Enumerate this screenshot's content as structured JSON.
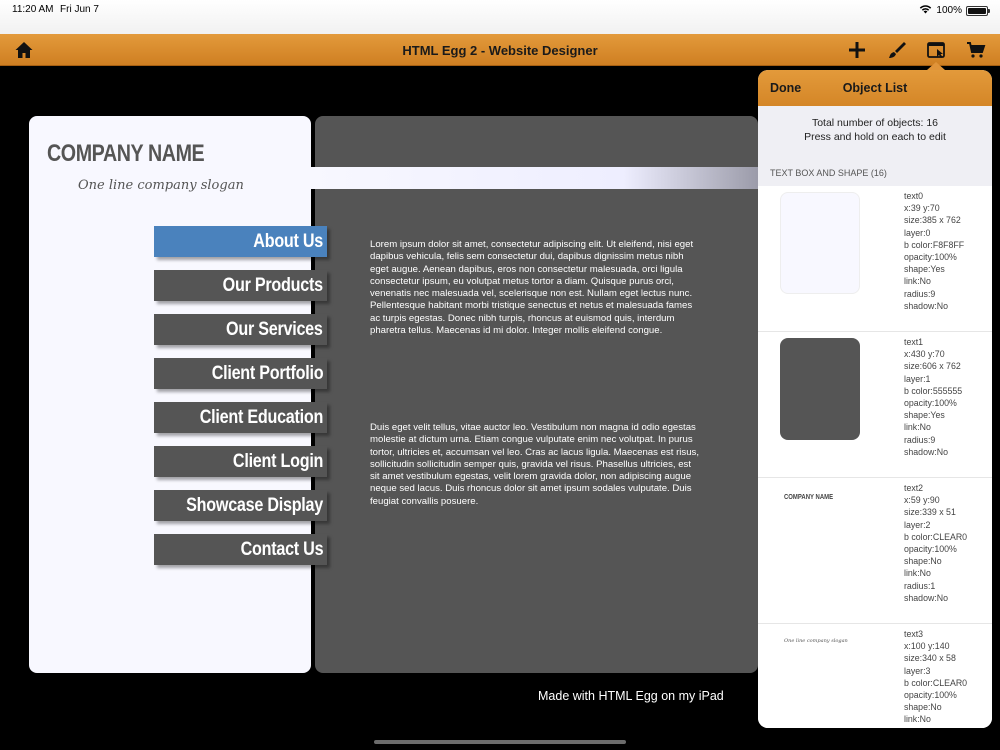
{
  "status_bar": {
    "time": "11:20 AM",
    "date": "Fri Jun 7",
    "battery": "100%"
  },
  "toolbar": {
    "title": "HTML Egg 2 - Website Designer",
    "icons": [
      "home-icon",
      "plus-icon",
      "brush-icon",
      "object-list-icon",
      "cart-icon"
    ]
  },
  "site": {
    "company_name": "COMPANY NAME",
    "slogan": "One line company slogan",
    "nav": [
      {
        "label": "About Us",
        "active": true
      },
      {
        "label": "Our Products",
        "active": false
      },
      {
        "label": "Our Services",
        "active": false
      },
      {
        "label": "Client Portfolio",
        "active": false
      },
      {
        "label": "Client Education",
        "active": false
      },
      {
        "label": "Client Login",
        "active": false
      },
      {
        "label": "Showcase Display",
        "active": false
      },
      {
        "label": "Contact Us",
        "active": false
      }
    ],
    "para1": "Lorem ipsum dolor sit amet, consectetur adipiscing elit. Ut eleifend, nisi eget dapibus vehicula, felis sem consectetur dui, dapibus dignissim metus nibh eget augue. Aenean dapibus, eros non consectetur malesuada, orci ligula consectetur ipsum, eu volutpat metus tortor a diam. Quisque purus orci, venenatis nec malesuada vel, scelerisque non est. Nullam eget lectus nunc. Pellentesque habitant morbi tristique senectus et netus et malesuada fames ac turpis egestas. Donec nibh turpis, rhoncus at euismod quis, interdum pharetra tellus. Maecenas id mi dolor. Integer mollis eleifend congue.",
    "para2": "Duis eget velit tellus, vitae auctor leo. Vestibulum non magna id odio egestas molestie at dictum urna. Etiam congue vulputate enim nec volutpat. In purus tortor, ultricies et, accumsan vel leo. Cras ac lacus ligula. Maecenas est risus, sollicitudin sollicitudin semper quis, gravida vel risus. Phasellus ultricies, est sit amet vestibulum egestas, velit lorem gravida dolor, non adipiscing augue neque sed lacus. Duis rhoncus dolor sit amet ipsum sodales vulputate. Duis feugiat convallis posuere.",
    "footer": "Made with HTML Egg on my iPad"
  },
  "popover": {
    "done": "Done",
    "title": "Object List",
    "info_line1": "Total number of objects: 16",
    "info_line2": "Press and hold on each to edit",
    "section": "TEXT BOX AND SHAPE (16)",
    "objects": [
      {
        "lines": [
          "text0",
          "x:39 y:70",
          "size:385 x 762",
          "layer:0",
          "b color:F8F8FF",
          "opacity:100%",
          "shape:Yes",
          "link:No",
          "radius:9",
          "shadow:No"
        ],
        "thumb_color": "#F8F8FF"
      },
      {
        "lines": [
          "text1",
          "x:430 y:70",
          "size:606 x 762",
          "layer:1",
          "b color:555555",
          "opacity:100%",
          "shape:Yes",
          "link:No",
          "radius:9",
          "shadow:No"
        ],
        "thumb_color": "#555555"
      },
      {
        "lines": [
          "text2",
          "x:59 y:90",
          "size:339 x 51",
          "layer:2",
          "b color:CLEAR0",
          "opacity:100%",
          "shape:No",
          "link:No",
          "radius:1",
          "shadow:No"
        ],
        "thumb_text": "COMPANY NAME"
      },
      {
        "lines": [
          "text3",
          "x:100 y:140",
          "size:340 x 58",
          "layer:3",
          "b color:CLEAR0",
          "opacity:100%",
          "shape:No",
          "link:No"
        ],
        "thumb_text": "One line company slogan"
      }
    ]
  }
}
